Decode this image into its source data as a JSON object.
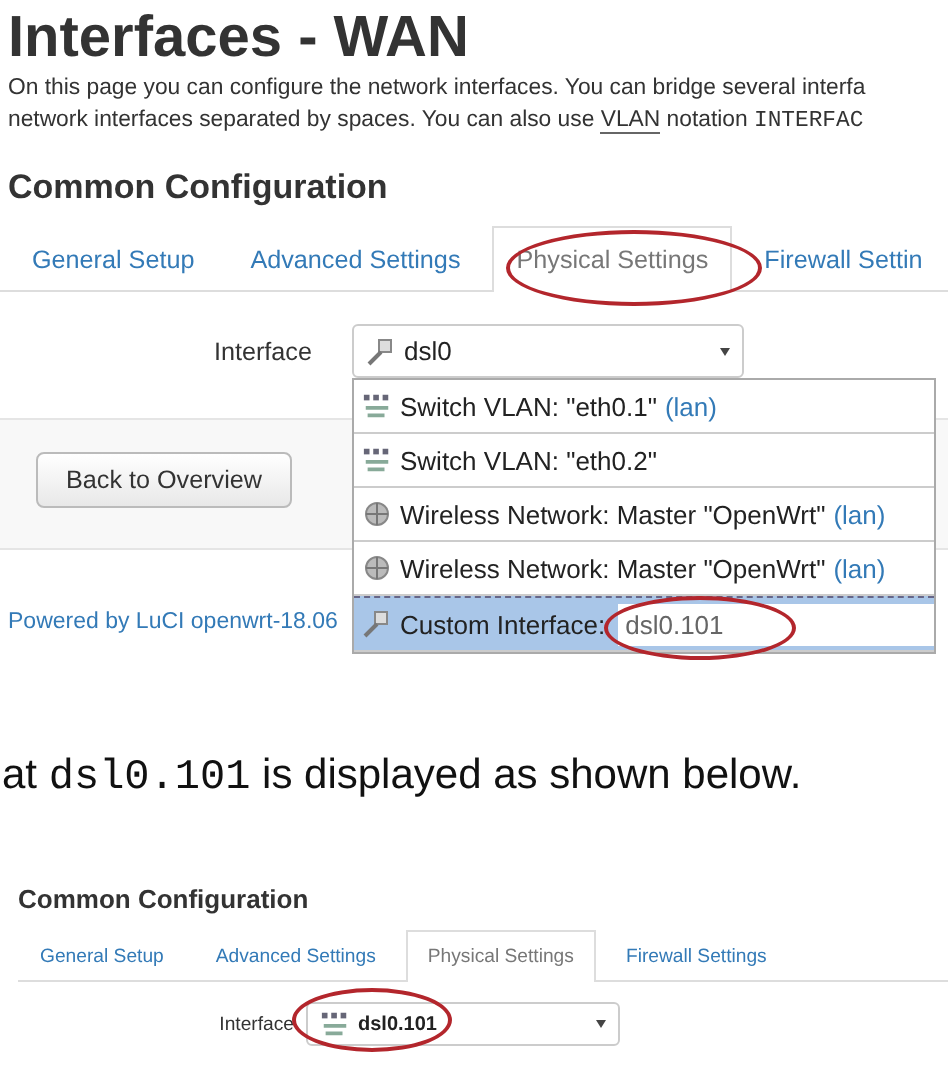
{
  "page_title": "Interfaces - WAN",
  "description": [
    [
      {
        "kind": "plain",
        "text": "On this page you can configure the network interfaces. You can bridge several interfa"
      }
    ],
    [
      {
        "kind": "plain",
        "text": "network interfaces separated by spaces. You can also use "
      },
      {
        "kind": "abbr",
        "text": "VLAN"
      },
      {
        "kind": "plain",
        "text": " notation "
      },
      {
        "kind": "code",
        "text": "INTERFAC"
      }
    ]
  ],
  "section_title": "Common Configuration",
  "tabs": [
    {
      "label": "General Setup",
      "selected": false
    },
    {
      "label": "Advanced Settings",
      "selected": false
    },
    {
      "label": "Physical Settings",
      "selected": true
    },
    {
      "label": "Firewall Settin",
      "selected": false
    }
  ],
  "interface": {
    "label": "Interface",
    "value": "dsl0",
    "kind": "custom"
  },
  "options": [
    {
      "label": "Switch VLAN: \"eth0.1\"",
      "suffix": "(lan)",
      "kind": "switch",
      "selected": false
    },
    {
      "label": "Switch VLAN: \"eth0.2\"",
      "kind": "switch",
      "selected": false
    },
    {
      "label": "Wireless Network: Master \"OpenWrt\"",
      "suffix": "(lan)",
      "kind": "wireless",
      "selected": false
    },
    {
      "label": "Wireless Network: Master \"OpenWrt\"",
      "suffix": "(lan)",
      "kind": "wireless",
      "selected": false
    },
    {
      "label": "Custom Interface:",
      "kind": "custom",
      "selected": true,
      "value": "dsl0.101"
    }
  ],
  "back_button": "Back to Overview",
  "footer": "Powered by LuCI openwrt-18.06",
  "caption": [
    {
      "kind": "plain",
      "text": "at "
    },
    {
      "kind": "code",
      "text": "dsl0.101"
    },
    {
      "kind": "plain",
      "text": " is displayed as shown below."
    }
  ],
  "second": {
    "section_title": "Common Configuration",
    "tabs": [
      {
        "label": "General Setup",
        "selected": false
      },
      {
        "label": "Advanced Settings",
        "selected": false
      },
      {
        "label": "Physical Settings",
        "selected": true
      },
      {
        "label": "Firewall Settings",
        "selected": false
      }
    ],
    "interface": {
      "label": "Interface",
      "value": "dsl0.101",
      "kind": "switch"
    }
  }
}
